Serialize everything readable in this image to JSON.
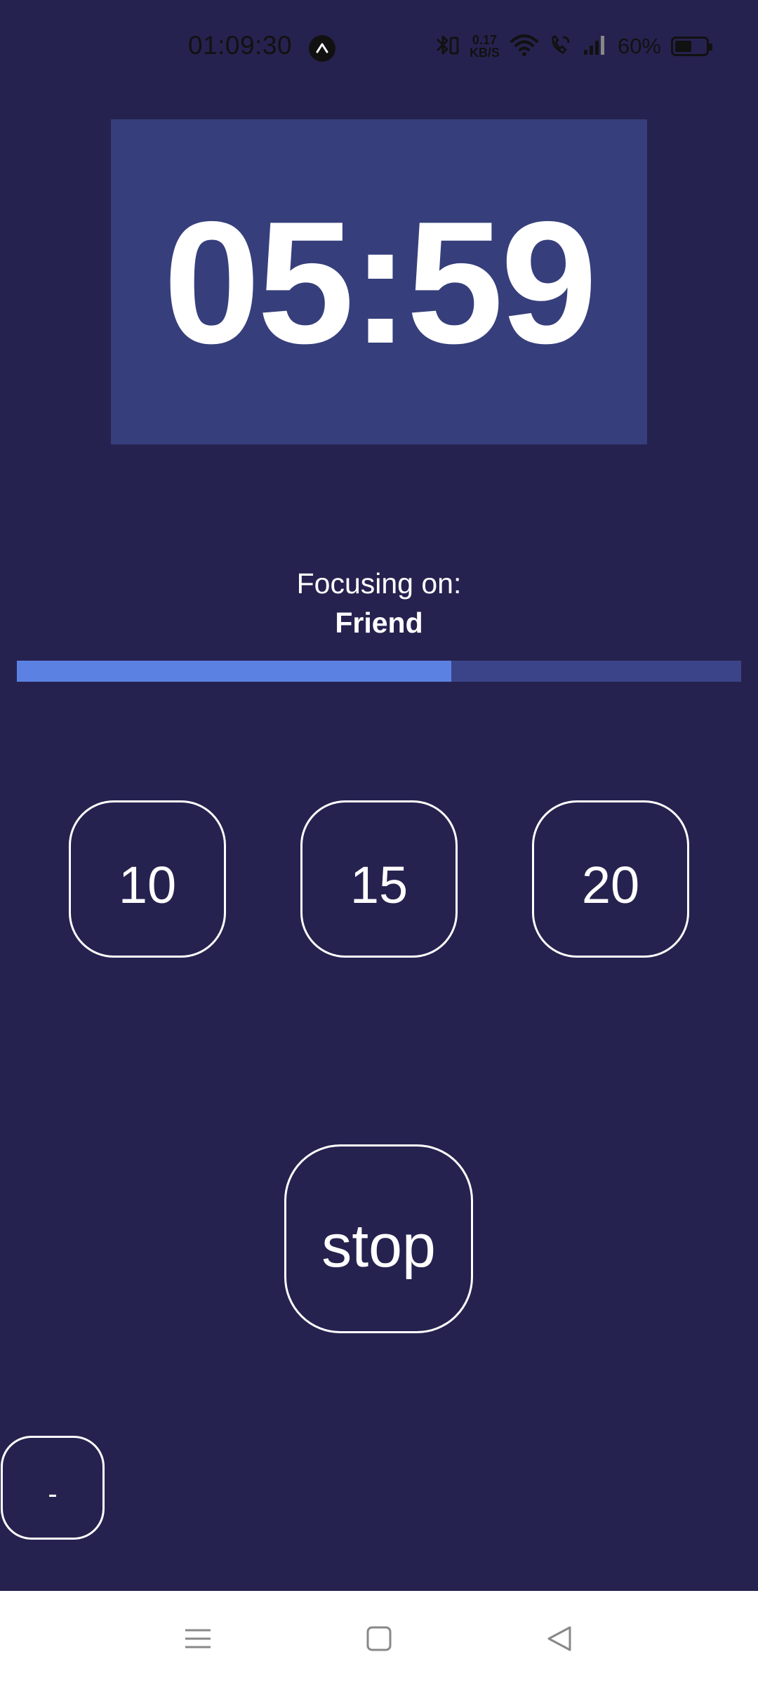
{
  "status_bar": {
    "time": "01:09:30",
    "net_speed_value": "0.17",
    "net_speed_unit": "KB/S",
    "battery_percent": "60%",
    "battery_level": 0.6,
    "icons": [
      "app-notification-icon",
      "bluetooth-icon",
      "wifi-icon",
      "wifi-calling-icon",
      "signal-icon",
      "battery-icon"
    ]
  },
  "timer": {
    "display": "05:59"
  },
  "focus": {
    "label": "Focusing on:",
    "name": "Friend"
  },
  "progress": {
    "value_fraction": 0.6
  },
  "presets": [
    {
      "label": "10"
    },
    {
      "label": "15"
    },
    {
      "label": "20"
    }
  ],
  "controls": {
    "stop_label": "stop",
    "minus_label": "-"
  },
  "nav": {
    "icons": [
      "menu-icon",
      "home-icon",
      "back-icon"
    ]
  },
  "colors": {
    "background": "#26224f",
    "timer_box": "#363f7b",
    "progress_track": "#3b4488",
    "progress_fill": "#5b82e2",
    "nav_bar": "#ffffff"
  }
}
